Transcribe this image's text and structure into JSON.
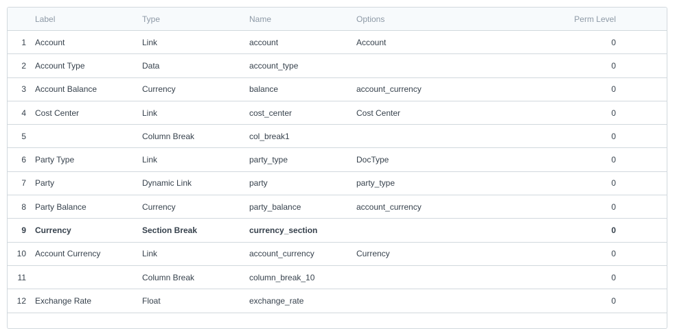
{
  "columns": {
    "label": "Label",
    "type": "Type",
    "name": "Name",
    "options": "Options",
    "perm_level": "Perm Level"
  },
  "rows": [
    {
      "idx": "1",
      "label": "Account",
      "type": "Link",
      "name": "account",
      "options": "Account",
      "perm": "0",
      "bold": false
    },
    {
      "idx": "2",
      "label": "Account Type",
      "type": "Data",
      "name": "account_type",
      "options": "",
      "perm": "0",
      "bold": false
    },
    {
      "idx": "3",
      "label": "Account Balance",
      "type": "Currency",
      "name": "balance",
      "options": "account_currency",
      "perm": "0",
      "bold": false
    },
    {
      "idx": "4",
      "label": "Cost Center",
      "type": "Link",
      "name": "cost_center",
      "options": "Cost Center",
      "perm": "0",
      "bold": false
    },
    {
      "idx": "5",
      "label": "",
      "type": "Column Break",
      "name": "col_break1",
      "options": "",
      "perm": "0",
      "bold": false
    },
    {
      "idx": "6",
      "label": "Party Type",
      "type": "Link",
      "name": "party_type",
      "options": "DocType",
      "perm": "0",
      "bold": false
    },
    {
      "idx": "7",
      "label": "Party",
      "type": "Dynamic Link",
      "name": "party",
      "options": "party_type",
      "perm": "0",
      "bold": false
    },
    {
      "idx": "8",
      "label": "Party Balance",
      "type": "Currency",
      "name": "party_balance",
      "options": "account_currency",
      "perm": "0",
      "bold": false
    },
    {
      "idx": "9",
      "label": "Currency",
      "type": "Section Break",
      "name": "currency_section",
      "options": "",
      "perm": "0",
      "bold": true
    },
    {
      "idx": "10",
      "label": "Account Currency",
      "type": "Link",
      "name": "account_currency",
      "options": "Currency",
      "perm": "0",
      "bold": false
    },
    {
      "idx": "11",
      "label": "",
      "type": "Column Break",
      "name": "column_break_10",
      "options": "",
      "perm": "0",
      "bold": false
    },
    {
      "idx": "12",
      "label": "Exchange Rate",
      "type": "Float",
      "name": "exchange_rate",
      "options": "",
      "perm": "0",
      "bold": false
    }
  ]
}
